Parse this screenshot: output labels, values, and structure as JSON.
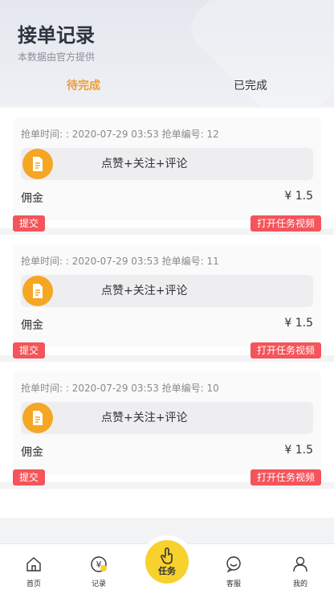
{
  "header": {
    "title": "接单记录",
    "subtitle": "本数据由官方提供"
  },
  "tabs": [
    {
      "label": "待完成",
      "active": true
    },
    {
      "label": "已完成",
      "active": false
    }
  ],
  "cards": [
    {
      "meta": "抢单时间: : 2020-07-29 03:53 抢单编号: 12",
      "task": "点赞+关注+评论",
      "commission_label": "佣金",
      "amount": "¥ 1.5",
      "submit": "提交",
      "open_video": "打开任务视频"
    },
    {
      "meta": "抢单时间: : 2020-07-29 03:53 抢单编号: 11",
      "task": "点赞+关注+评论",
      "commission_label": "佣金",
      "amount": "¥ 1.5",
      "submit": "提交",
      "open_video": "打开任务视频"
    },
    {
      "meta": "抢单时间: : 2020-07-29 03:53 抢单编号: 10",
      "task": "点赞+关注+评论",
      "commission_label": "佣金",
      "amount": "¥ 1.5",
      "submit": "提交",
      "open_video": "打开任务视频"
    }
  ],
  "tabbar": {
    "home": "首页",
    "records": "记录",
    "task": "任务",
    "service": "客服",
    "mine": "我的"
  },
  "colors": {
    "accent": "#f39c2d",
    "button": "#f4545a",
    "icon_bg": "#f5a623",
    "center": "#f7d12c"
  },
  "icons": {
    "task": "document-icon",
    "home": "home-icon",
    "records": "yen-coin-icon",
    "center": "hand-touch-icon",
    "service": "chat-bubble-icon",
    "mine": "user-icon"
  }
}
